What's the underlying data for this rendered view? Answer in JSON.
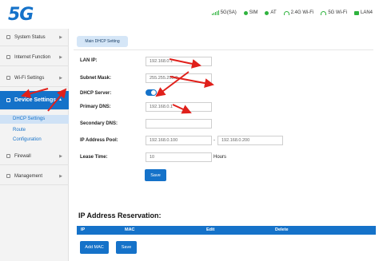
{
  "header": {
    "logo": "5G",
    "status": [
      {
        "label": "5G(SA)",
        "icon": "signal-bars-icon"
      },
      {
        "label": "SIM",
        "icon": "sim-icon"
      },
      {
        "label": "AT",
        "icon": "at-icon"
      },
      {
        "label": "2.4G Wi-Fi",
        "icon": "wifi-icon"
      },
      {
        "label": "5G Wi-Fi",
        "icon": "wifi-icon"
      },
      {
        "label": "LAN4",
        "icon": "lan-icon"
      }
    ]
  },
  "sidebar": {
    "items": [
      {
        "label": "System Status"
      },
      {
        "label": "Internet Function"
      },
      {
        "label": "Wi-Fi Settings"
      },
      {
        "label": "Device Settings"
      },
      {
        "label": "Firewall"
      },
      {
        "label": "Management"
      }
    ],
    "subitems": [
      {
        "label": "DHCP Settings"
      },
      {
        "label": "Route"
      },
      {
        "label": "Configuration"
      }
    ]
  },
  "main": {
    "tab_label": "Main DHCP Setting",
    "form": {
      "lan_ip_label": "LAN IP:",
      "lan_ip_value": "192.168.0.1",
      "subnet_label": "Subnet Mask:",
      "subnet_value": "255.255.255.0",
      "dhcp_label": "DHCP Server:",
      "dhcp_enabled": true,
      "primary_dns_label": "Primary DNS:",
      "primary_dns_value": "192.168.0.1",
      "secondary_dns_label": "Secondary DNS:",
      "secondary_dns_value": "",
      "pool_label": "IP Address Pool:",
      "pool_start": "192.168.0.100",
      "pool_separator": "-",
      "pool_end": "192.168.0.200",
      "lease_label": "Lease Time:",
      "lease_value": "10",
      "lease_unit": "Hours",
      "save_label": "Save"
    },
    "reservation": {
      "title": "IP Address Reservation:",
      "columns": [
        "IP",
        "MAC",
        "Edit",
        "Delete"
      ],
      "add_label": "Add MAC",
      "save_label": "Save"
    }
  },
  "colors": {
    "accent": "#1572c9",
    "status_green": "#2fb33e",
    "annotation_red": "#e0201b"
  }
}
